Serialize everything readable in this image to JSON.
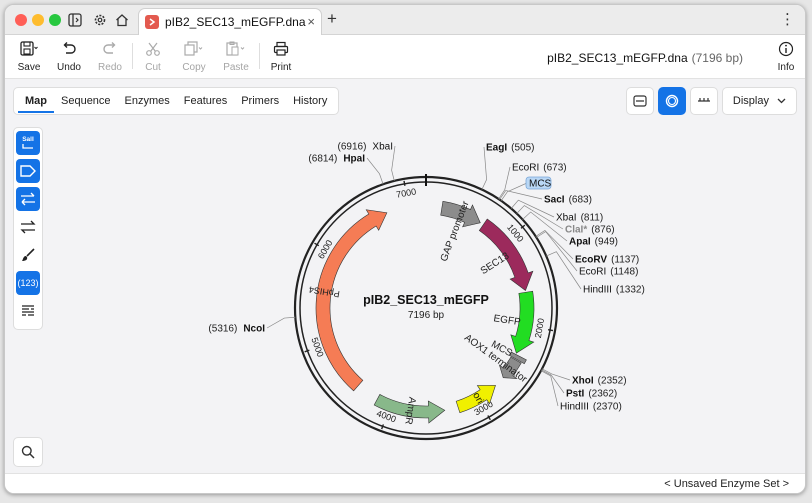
{
  "window": {
    "tab_title": "pIB2_SEC13_mEGFP.dna",
    "tab_close": "×",
    "new_tab": "+",
    "more": "⋮"
  },
  "toolbar": {
    "save": "Save",
    "undo": "Undo",
    "redo": "Redo",
    "cut": "Cut",
    "copy": "Copy",
    "paste": "Paste",
    "print": "Print",
    "info": "Info",
    "doc_name": "pIB2_SEC13_mEGFP.dna",
    "doc_size": "(7196 bp)"
  },
  "view_tabs": [
    "Map",
    "Sequence",
    "Enzymes",
    "Features",
    "Primers",
    "History"
  ],
  "display_label": "Display",
  "side_tools": {
    "sall_label": "SalI",
    "counter_label": "(123)"
  },
  "map": {
    "name": "pIB2_SEC13_mEGFP",
    "length": "7196 bp",
    "ticks": [
      {
        "label": "1000",
        "bp": 1000
      },
      {
        "label": "2000",
        "bp": 2000
      },
      {
        "label": "3000",
        "bp": 3000
      },
      {
        "label": "4000",
        "bp": 4000
      },
      {
        "label": "5000",
        "bp": 5000
      },
      {
        "label": "6000",
        "bp": 6000
      },
      {
        "label": "7000",
        "bp": 7000
      }
    ],
    "features": [
      {
        "name": "GAP promoter",
        "start": 180,
        "end": 650,
        "color": "#8c8c8c",
        "dir": 1
      },
      {
        "name": "SEC13",
        "start": 690,
        "end": 1600,
        "color": "#9c2a5c",
        "dir": 1
      },
      {
        "name": "EGFP",
        "start": 1620,
        "end": 2330,
        "color": "#22dd22",
        "dir": 1
      },
      {
        "name": "MCS",
        "start": 2345,
        "end": 2390,
        "color": "#8c8c8c",
        "dir": 1
      },
      {
        "name": "AOX1 terminator",
        "start": 2400,
        "end": 2640,
        "color": "#8c8c8c",
        "dir": 1
      },
      {
        "name": "ori",
        "start": 2760,
        "end": 3240,
        "color": "#f0f000",
        "dir": -1
      },
      {
        "name": "AmpR",
        "start": 3390,
        "end": 4160,
        "color": "#88b88a",
        "dir": -1
      },
      {
        "name": "PpHIS4",
        "start": 4420,
        "end": 6750,
        "color": "#f57c55",
        "dir": 1
      }
    ],
    "sites": [
      {
        "name": "EagI",
        "pos": "(505)",
        "bold": true,
        "bp": 505,
        "side": "right"
      },
      {
        "name": "EcoRI",
        "pos": "(673)",
        "bold": false,
        "bp": 673,
        "side": "right"
      },
      {
        "name": "MCS",
        "pos": "",
        "bold": false,
        "bp": 700,
        "side": "right",
        "box": true
      },
      {
        "name": "SacI",
        "pos": "(683)",
        "bold": true,
        "bp": 683,
        "side": "right"
      },
      {
        "name": "XbaI",
        "pos": "(811)",
        "bold": false,
        "bp": 811,
        "side": "right"
      },
      {
        "name": "ClaI*",
        "pos": "(876)",
        "bold": true,
        "bp": 876,
        "side": "right",
        "gray": true
      },
      {
        "name": "ApaI",
        "pos": "(949)",
        "bold": true,
        "bp": 949,
        "side": "right"
      },
      {
        "name": "EcoRV",
        "pos": "(1137)",
        "bold": true,
        "bp": 1137,
        "side": "right"
      },
      {
        "name": "EcoRI",
        "pos": "(1148)",
        "bold": false,
        "bp": 1148,
        "side": "right"
      },
      {
        "name": "HindIII",
        "pos": "(1332)",
        "bold": false,
        "bp": 1332,
        "side": "right"
      },
      {
        "name": "XhoI",
        "pos": "(2352)",
        "bold": true,
        "bp": 2352,
        "side": "right"
      },
      {
        "name": "PstI",
        "pos": "(2362)",
        "bold": true,
        "bp": 2362,
        "side": "right"
      },
      {
        "name": "HindIII",
        "pos": "(2370)",
        "bold": false,
        "bp": 2370,
        "side": "right"
      },
      {
        "name": "NcoI",
        "pos": "(5316)",
        "bold": true,
        "bp": 5316,
        "side": "left"
      },
      {
        "name": "HpaI",
        "pos": "(6814)",
        "bold": true,
        "bp": 6814,
        "side": "left"
      },
      {
        "name": "XbaI",
        "pos": "(6916)",
        "bold": false,
        "bp": 6916,
        "side": "left"
      }
    ]
  },
  "status": {
    "enzyme_set": "< Unsaved Enzyme Set >"
  },
  "colors": {
    "accent": "#1473e6",
    "close_light": "#ff5f57",
    "minimize_light": "#febc2e",
    "zoom_light": "#28c840"
  }
}
